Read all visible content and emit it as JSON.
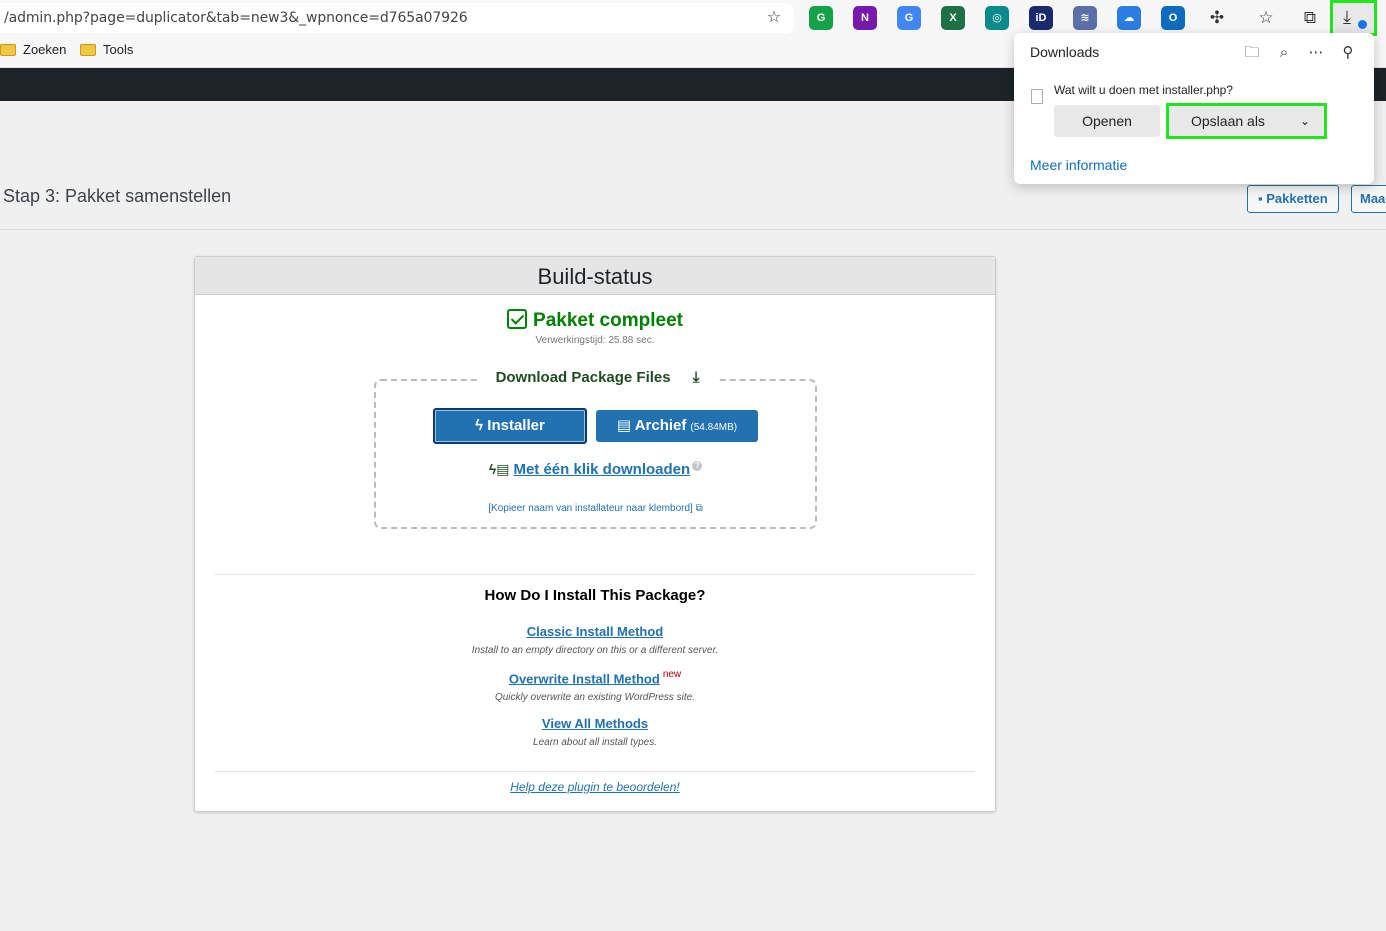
{
  "browser": {
    "url": "/admin.php?page=duplicator&tab=new3&_wpnonce=d765a07926",
    "bookmarks": [
      "Zoeken",
      "Tools"
    ],
    "extensions": [
      {
        "name": "grammarly-icon",
        "label": "G",
        "color": "#15a34a"
      },
      {
        "name": "onenote-icon",
        "label": "N",
        "color": "#7719aa"
      },
      {
        "name": "translate-icon",
        "label": "G",
        "color": "#4285f4"
      },
      {
        "name": "sheets-icon",
        "label": "X",
        "color": "#1e7145"
      },
      {
        "name": "target-icon",
        "label": "◎",
        "color": "#0a8a8a"
      },
      {
        "name": "id-icon",
        "label": "iD",
        "color": "#1a2b6d"
      },
      {
        "name": "edit-icon",
        "label": "≋",
        "color": "#5b6fa8"
      },
      {
        "name": "cloud-icon",
        "label": "☁",
        "color": "#2a7de1"
      },
      {
        "name": "outlook-icon",
        "label": "O",
        "color": "#0f6cbd"
      }
    ]
  },
  "wp": {
    "page_title": "Stap 3: Pakket samenstellen",
    "btn_packages": "Pakketten",
    "btn_new": "Maa"
  },
  "panel": {
    "title": "Build-status",
    "complete": "Pakket compleet",
    "processing_time": "Verwerkingstijd: 25.88 sec.",
    "download_legend": "Download Package Files",
    "installer_btn": "Installer",
    "archive_btn": "Archief",
    "archive_size": "(54.84MB)",
    "one_click": "Met één klik downloaden",
    "copy_name": "[Kopieer naam van installateur naar klembord]",
    "how_title": "How Do I Install This Package?",
    "methods": [
      {
        "title": "Classic Install Method",
        "desc": "Install to an empty directory on this or a different server.",
        "badge": ""
      },
      {
        "title": "Overwrite Install Method",
        "desc": "Quickly overwrite an existing WordPress site.",
        "badge": "new"
      },
      {
        "title": "View All Methods",
        "desc": "Learn about all install types.",
        "badge": ""
      }
    ],
    "rate": "Help deze plugin te beoordelen!"
  },
  "downloads_popup": {
    "title": "Downloads",
    "question": "Wat wilt u doen met installer.php?",
    "open_btn": "Openen",
    "save_as_btn": "Opslaan als",
    "more_info": "Meer informatie"
  },
  "colors": {
    "highlight": "#22e61c",
    "wp_blue": "#2271b1",
    "success_green": "#008000"
  }
}
